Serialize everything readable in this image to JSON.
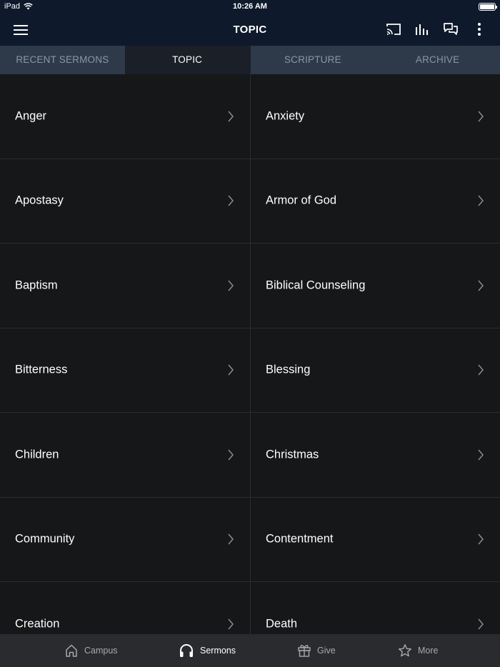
{
  "status_bar": {
    "device": "iPad",
    "time": "10:26 AM"
  },
  "navbar": {
    "title": "TOPIC"
  },
  "tabs": [
    {
      "label": "RECENT SERMONS",
      "active": false
    },
    {
      "label": "TOPIC",
      "active": true
    },
    {
      "label": "SCRIPTURE",
      "active": false
    },
    {
      "label": "ARCHIVE",
      "active": false
    }
  ],
  "topics": {
    "left": [
      "Anger",
      "Apostasy",
      "Baptism",
      "Bitterness",
      "Children",
      "Community",
      "Creation"
    ],
    "right": [
      "Anxiety",
      "Armor of God",
      "Biblical Counseling",
      "Blessing",
      "Christmas",
      "Contentment",
      "Death"
    ]
  },
  "tabbar": [
    {
      "label": "Campus",
      "icon": "home-icon",
      "active": false
    },
    {
      "label": "Sermons",
      "icon": "headphones-icon",
      "active": true
    },
    {
      "label": "Give",
      "icon": "gift-icon",
      "active": false
    },
    {
      "label": "More",
      "icon": "star-icon",
      "active": false
    }
  ],
  "colors": {
    "header_bg": "#0e1a2c",
    "tabs_bg": "#2e3a4a",
    "active_tab_bg": "#1a1f28",
    "content_bg": "#161719",
    "tabbar_bg": "#2a2b2e"
  }
}
